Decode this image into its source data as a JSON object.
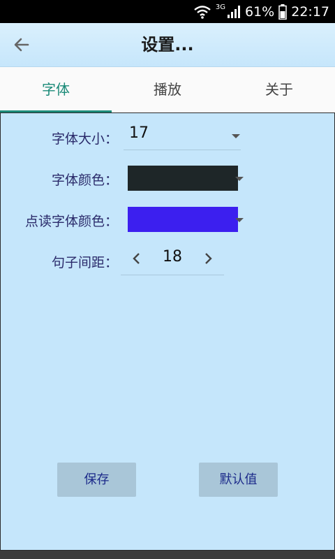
{
  "status_bar": {
    "network": "3G",
    "battery": "61%",
    "time": "22:17"
  },
  "app_bar": {
    "title": "设置..."
  },
  "tabs": [
    {
      "label": "字体",
      "active": true
    },
    {
      "label": "播放",
      "active": false
    },
    {
      "label": "关于",
      "active": false
    }
  ],
  "settings": {
    "font_size": {
      "label": "字体大小：",
      "value": "17"
    },
    "font_color": {
      "label": "字体颜色：",
      "color": "#1e2628"
    },
    "highlight_color": {
      "label": "点读字体颜色：",
      "color": "#3c1fef"
    },
    "line_spacing": {
      "label": "句子间距：",
      "value": "18"
    }
  },
  "buttons": {
    "save": "保存",
    "defaults": "默认值"
  },
  "colors": {
    "accent": "#1b8a78",
    "panel_bg": "#c5e6fb",
    "button_bg": "#a9c6d8"
  }
}
